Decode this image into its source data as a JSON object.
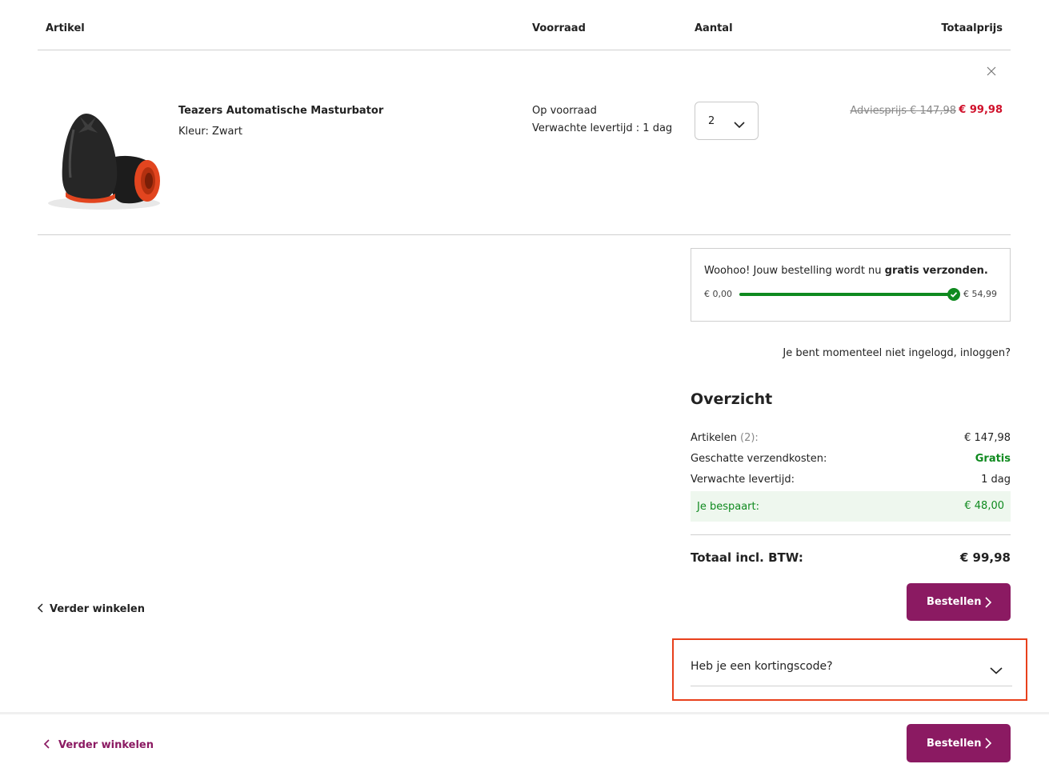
{
  "table": {
    "headers": {
      "article": "Artikel",
      "stock": "Voorraad",
      "quantity": "Aantal",
      "total_price": "Totaalprijs"
    }
  },
  "item": {
    "name": "Teazers Automatische Masturbator",
    "color": "Kleur: Zwart",
    "stock_status": "Op voorraad",
    "delivery": "Verwachte levertijd : 1 dag",
    "quantity": "2",
    "rrp": "Adviesprijs € 147,98",
    "price": "€ 99,98",
    "remove_icon": "close-icon"
  },
  "shipping": {
    "message_prefix": "Woohoo! Jouw bestelling wordt nu ",
    "message_bold": "gratis verzonden.",
    "min": "€ 0,00",
    "max": "€ 54,99",
    "progress_percent": 100
  },
  "login_prompt": "Je bent momenteel niet ingelogd, inloggen?",
  "overview": {
    "title": "Overzicht",
    "articles_label": "Artikelen",
    "articles_count": "(2):",
    "articles_value": "€ 147,98",
    "shipping_label": "Geschatte verzendkosten:",
    "shipping_value": "Gratis",
    "delivery_label": "Verwachte levertijd:",
    "delivery_value": "1 dag",
    "savings_label": "Je bespaart:",
    "savings_value": "€ 48,00",
    "total_label": "Totaal incl. BTW:",
    "total_value": "€ 99,98"
  },
  "actions": {
    "order": "Bestellen",
    "continue_shopping": "Verder winkelen"
  },
  "discount": {
    "label": "Heb je een kortingscode?"
  },
  "colors": {
    "brand": "#8b1a62",
    "sale": "#d0112b",
    "success": "#0f8a1f",
    "highlight": "#e8401c"
  }
}
